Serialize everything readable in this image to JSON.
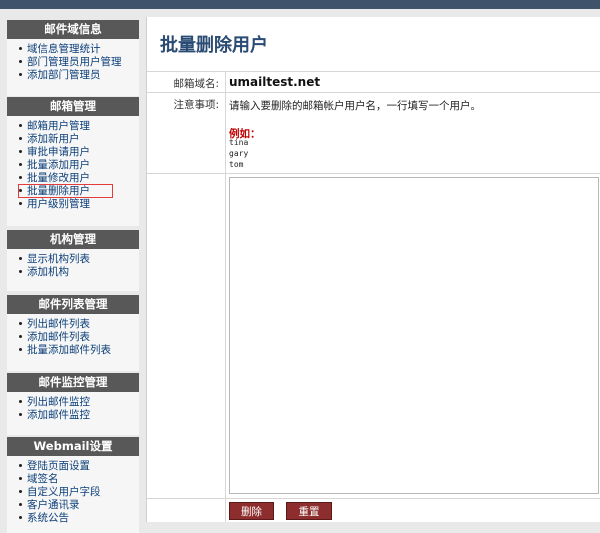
{
  "sidebar": {
    "sections": [
      {
        "title": "邮件域信息",
        "items": [
          "域信息管理统计",
          "部门管理员用户管理",
          "添加部门管理员"
        ]
      },
      {
        "title": "邮箱管理",
        "items": [
          "邮箱用户管理",
          "添加新用户",
          "审批申请用户",
          "批量添加用户",
          "批量修改用户",
          "批量删除用户",
          "用户级别管理"
        ]
      },
      {
        "title": "机构管理",
        "items": [
          "显示机构列表",
          "添加机构"
        ]
      },
      {
        "title": "邮件列表管理",
        "items": [
          "列出邮件列表",
          "添加邮件列表",
          "批量添加邮件列表"
        ]
      },
      {
        "title": "邮件监控管理",
        "items": [
          "列出邮件监控",
          "添加邮件监控"
        ]
      },
      {
        "title": "Webmail设置",
        "items": [
          "登陆页面设置",
          "域签名",
          "自定义用户字段",
          "客户通讯录",
          "系统公告"
        ]
      }
    ],
    "active_item": "批量删除用户"
  },
  "main": {
    "title": "批量删除用户",
    "domain_label": "邮箱域名:",
    "domain_value": "umailtest.net",
    "note_label": "注意事项:",
    "note_text": "请输入要删除的邮箱帐户用户名，一行填写一个用户。",
    "example_label": "例如：",
    "example_lines": [
      "tina",
      "gary",
      "tom"
    ],
    "textarea_value": "",
    "delete_button": "删除",
    "reset_button": "重置"
  }
}
